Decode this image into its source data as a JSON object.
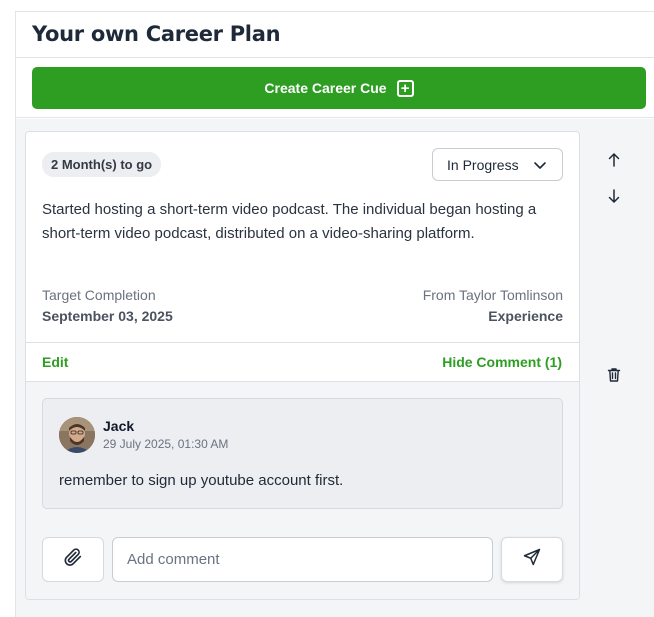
{
  "page": {
    "title": "Your own Career Plan"
  },
  "toolbar": {
    "create_label": "Create Career Cue",
    "create_icon": "plus-square-icon"
  },
  "colors": {
    "accent": "#2e9e23",
    "background": "#f4f5f7",
    "border": "#dcdfe4"
  },
  "card": {
    "due_badge": "2 Month(s) to go",
    "status": {
      "selected": "In Progress"
    },
    "description": "Started hosting a short-term video podcast. The individual began hosting a short-term video podcast, distributed on a video-sharing platform.",
    "target_label": "Target Completion",
    "target_date": "September 03, 2025",
    "source_label": "From Taylor Tomlinson",
    "source_type": "Experience",
    "edit_label": "Edit",
    "hide_comment_label": "Hide Comment (1)"
  },
  "comments": [
    {
      "author": "Jack",
      "time": "29 July 2025, 01:30 AM",
      "text": "remember to sign up youtube account first."
    }
  ],
  "composer": {
    "placeholder": "Add comment"
  },
  "side_controls": [
    "arrow-up-icon",
    "arrow-down-icon",
    "trash-icon"
  ]
}
